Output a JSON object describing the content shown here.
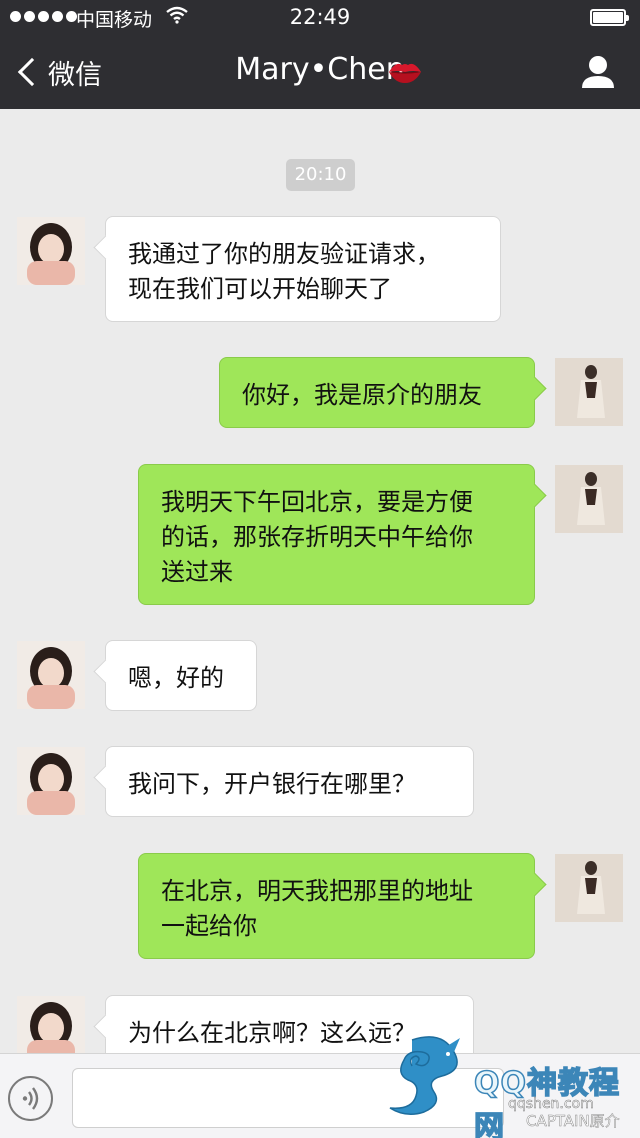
{
  "status_bar": {
    "carrier": "中国移动",
    "time": "22:49"
  },
  "nav": {
    "back_label": "微信",
    "title": "Mary•Chen"
  },
  "chat": {
    "timestamp": "20:10",
    "messages": [
      {
        "side": "in",
        "lines": [
          "我通过了你的朋友验证请求，",
          "现在我们可以开始聊天了"
        ]
      },
      {
        "side": "out",
        "lines": [
          "你好，我是原介的朋友"
        ]
      },
      {
        "side": "out",
        "lines": [
          "我明天下午回北京，要是方便",
          "的话，那张存折明天中午给你",
          "送过来"
        ]
      },
      {
        "side": "in",
        "lines": [
          "嗯，好的"
        ]
      },
      {
        "side": "in",
        "lines": [
          "我问下，开户银行在哪里？"
        ]
      },
      {
        "side": "out",
        "lines": [
          "在北京，明天我把那里的地址",
          "一起给你"
        ]
      },
      {
        "side": "in",
        "lines": [
          "为什么在北京啊？这么远？"
        ]
      }
    ]
  },
  "input": {
    "value": ""
  },
  "watermark": {
    "title": "QQ神教程网",
    "url": "qqshen.com",
    "sub": "CAPTAIN原介"
  },
  "colors": {
    "bar_bg": "#2e2e32",
    "chat_bg": "#ebebeb",
    "bubble_out": "#9fe659",
    "bubble_in": "#ffffff"
  }
}
